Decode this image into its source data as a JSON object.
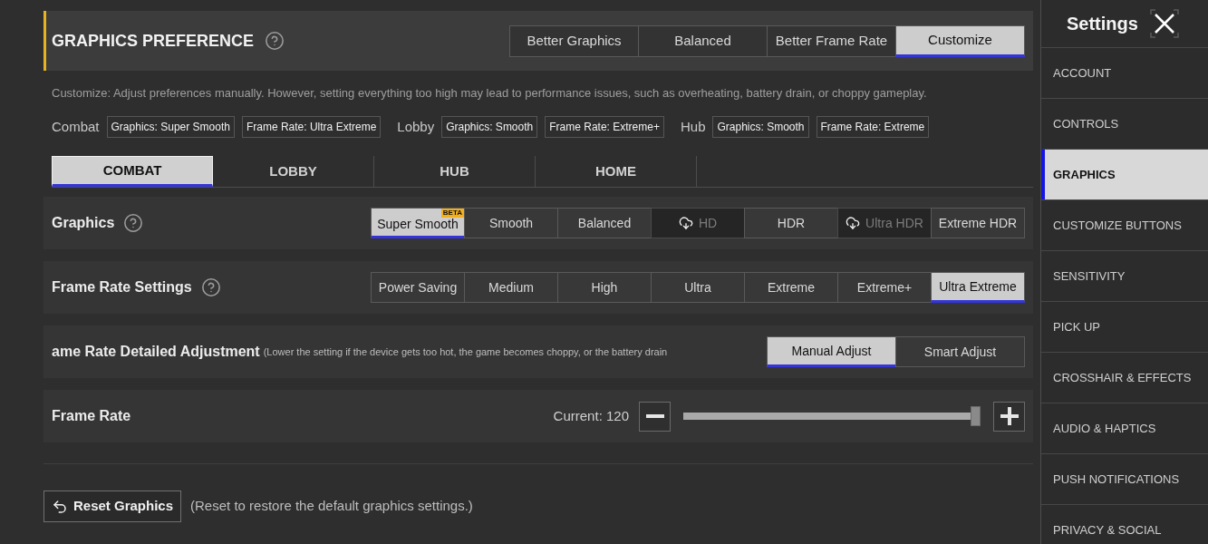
{
  "preference": {
    "title": "GRAPHICS PREFERENCE",
    "help": true,
    "options": [
      {
        "label": "Better Graphics",
        "selected": false
      },
      {
        "label": "Balanced",
        "selected": false
      },
      {
        "label": "Better Frame Rate",
        "selected": false
      },
      {
        "label": "Customize",
        "selected": true
      }
    ],
    "description": "Customize: Adjust preferences manually. However, setting everything too high may lead to performance issues, such as overheating, battery drain, or choppy gameplay.",
    "summary": [
      {
        "mode": "Combat",
        "tags": [
          "Graphics: Super Smooth",
          "Frame Rate: Ultra Extreme"
        ]
      },
      {
        "mode": "Lobby",
        "tags": [
          "Graphics: Smooth",
          "Frame Rate: Extreme+"
        ]
      },
      {
        "mode": "Hub",
        "tags": [
          "Graphics: Smooth",
          "Frame Rate: Extreme"
        ]
      }
    ]
  },
  "mode_tabs": [
    {
      "label": "COMBAT",
      "selected": true
    },
    {
      "label": "LOBBY",
      "selected": false
    },
    {
      "label": "HUB",
      "selected": false
    },
    {
      "label": "HOME",
      "selected": false
    }
  ],
  "settings": [
    {
      "kind": "options",
      "label": "Graphics",
      "help": true,
      "options": [
        {
          "label": "Super Smooth",
          "selected": true,
          "downloaded": true,
          "badge": "BETA"
        },
        {
          "label": "Smooth",
          "selected": false,
          "downloaded": true
        },
        {
          "label": "Balanced",
          "selected": false,
          "downloaded": true
        },
        {
          "label": "HD",
          "selected": false,
          "downloaded": false
        },
        {
          "label": "HDR",
          "selected": false,
          "downloaded": true
        },
        {
          "label": "Ultra HDR",
          "selected": false,
          "downloaded": false
        },
        {
          "label": "Extreme HDR",
          "selected": false,
          "downloaded": true
        }
      ]
    },
    {
      "kind": "options",
      "label": "Frame Rate Settings",
      "help": true,
      "options": [
        {
          "label": "Power Saving",
          "selected": false
        },
        {
          "label": "Medium",
          "selected": false
        },
        {
          "label": "High",
          "selected": false
        },
        {
          "label": "Ultra",
          "selected": false
        },
        {
          "label": "Extreme",
          "selected": false
        },
        {
          "label": "Extreme+",
          "selected": false
        },
        {
          "label": "Ultra Extreme",
          "selected": true
        }
      ]
    },
    {
      "kind": "options",
      "label": "ame Rate Detailed Adjustment",
      "note": "(Lower the setting if the device gets too hot, the game becomes choppy, or the battery drain",
      "help": false,
      "options": [
        {
          "label": "Manual Adjust",
          "selected": true
        },
        {
          "label": "Smart Adjust",
          "selected": false
        }
      ]
    },
    {
      "kind": "slider",
      "label": "Frame Rate",
      "reading": "Current: 120",
      "level": 1
    }
  ],
  "reset": {
    "button": "Reset Graphics",
    "note": "(Reset to restore the default graphics settings.)"
  },
  "sidebar": {
    "title": "Settings",
    "items": [
      {
        "label": "ACCOUNT",
        "selected": false
      },
      {
        "label": "CONTROLS",
        "selected": false
      },
      {
        "label": "GRAPHICS",
        "selected": true
      },
      {
        "label": "CUSTOMIZE BUTTONS",
        "selected": false
      },
      {
        "label": "SENSITIVITY",
        "selected": false
      },
      {
        "label": "PICK UP",
        "selected": false
      },
      {
        "label": "CROSSHAIR & EFFECTS",
        "selected": false
      },
      {
        "label": "AUDIO & HAPTICS",
        "selected": false
      },
      {
        "label": "PUSH NOTIFICATIONS",
        "selected": false
      },
      {
        "label": "PRIVACY & SOCIAL",
        "selected": false
      }
    ]
  }
}
